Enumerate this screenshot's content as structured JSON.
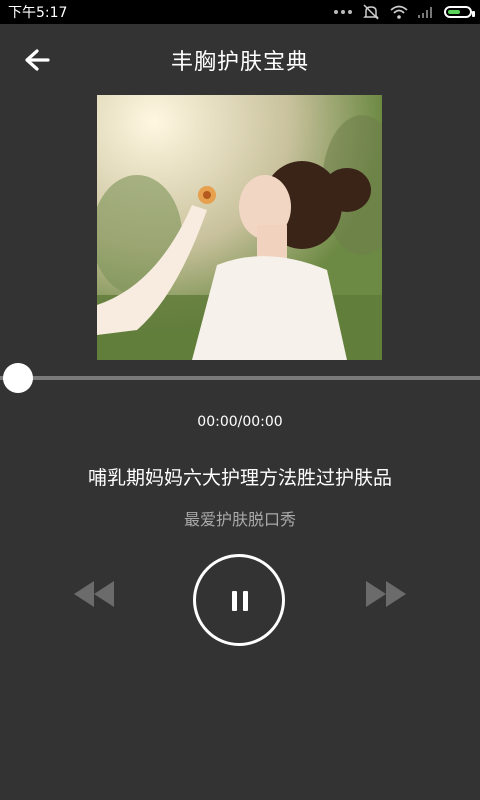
{
  "status_bar": {
    "time": "下午5:17",
    "icons": [
      "more-dots-icon",
      "mute-icon",
      "wifi-icon",
      "signal-icon",
      "battery-icon"
    ],
    "battery_color": "#5ad35a"
  },
  "header": {
    "title": "丰胸护肤宝典",
    "back_icon": "back-arrow-icon"
  },
  "player": {
    "timecode": "00:00/00:00",
    "progress_fraction": 0.0,
    "song_title": "哺乳期妈妈六大护理方法胜过护肤品",
    "artist": "最爱护肤脱口秀",
    "controls": {
      "prev_icon": "rewind-icon",
      "play_state_icon": "pause-icon",
      "next_icon": "fast-forward-icon"
    }
  },
  "colors": {
    "background": "#333333",
    "progress_track": "#7a7a7a",
    "secondary_text": "#a9a9a9"
  }
}
